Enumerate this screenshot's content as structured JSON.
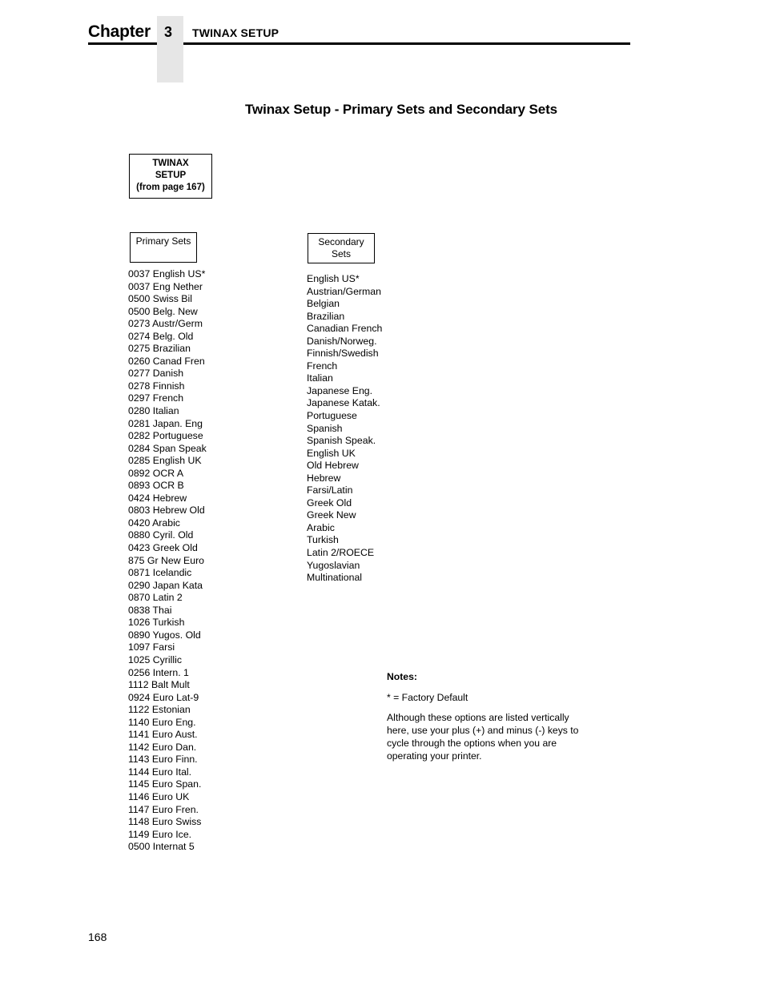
{
  "header": {
    "chapter_word": "Chapter",
    "chapter_number": "3",
    "running_title": "TWINAX SETUP"
  },
  "section_title": "Twinax Setup - Primary Sets and Secondary Sets",
  "flow": {
    "entry_box": {
      "line1": "TWINAX",
      "line2": "SETUP",
      "line3": "(from page 167)"
    },
    "primary_box": {
      "line1": "Primary Sets",
      "line2": ""
    },
    "secondary_box": {
      "line1": "Secondary",
      "line2": "Sets"
    }
  },
  "primary_sets": [
    "0037 English US*",
    "0037 Eng Nether",
    "0500 Swiss Bil",
    "0500 Belg. New",
    "0273 Austr/Germ",
    "0274 Belg. Old",
    "0275 Brazilian",
    "0260 Canad Fren",
    "0277 Danish",
    "0278 Finnish",
    "0297 French",
    "0280 Italian",
    "0281 Japan. Eng",
    "0282 Portuguese",
    "0284 Span Speak",
    "0285 English UK",
    "0892 OCR A",
    "0893 OCR B",
    "0424 Hebrew",
    "0803 Hebrew Old",
    "0420 Arabic",
    "0880 Cyril. Old",
    "0423 Greek Old",
    "875 Gr New Euro",
    "0871 Icelandic",
    "0290 Japan Kata",
    "0870 Latin 2",
    "0838 Thai",
    "1026 Turkish",
    "0890 Yugos. Old",
    "1097 Farsi",
    "1025 Cyrillic",
    "0256 Intern. 1",
    "1112 Balt Mult",
    "0924 Euro Lat-9",
    "1122 Estonian",
    "1140 Euro Eng.",
    "1141 Euro Aust.",
    "1142 Euro Dan.",
    "1143 Euro Finn.",
    "1144 Euro Ital.",
    "1145 Euro Span.",
    "1146 Euro UK",
    "1147 Euro Fren.",
    "1148 Euro Swiss",
    "1149 Euro Ice.",
    "0500 Internat 5"
  ],
  "secondary_sets": [
    "English US*",
    "Austrian/German",
    "Belgian",
    "Brazilian",
    "Canadian French",
    "Danish/Norweg.",
    "Finnish/Swedish",
    "French",
    "Italian",
    "Japanese Eng.",
    "Japanese Katak.",
    "Portuguese",
    "Spanish",
    "Spanish Speak.",
    "English UK",
    "Old Hebrew",
    "Hebrew",
    "Farsi/Latin",
    "Greek Old",
    "Greek New",
    "Arabic",
    "Turkish",
    "Latin 2/ROECE",
    "Yugoslavian",
    "Multinational"
  ],
  "notes": {
    "heading": "Notes:",
    "factory_default": "* = Factory Default",
    "paragraph": "Although these options are listed vertically here, use your plus (+) and minus (-) keys to cycle through the options when you are operating your printer."
  },
  "footer": {
    "page_number": "168"
  },
  "colors": {
    "text": "#000000",
    "tab_gray": "#e6e6e6",
    "page_background": "#ffffff"
  }
}
